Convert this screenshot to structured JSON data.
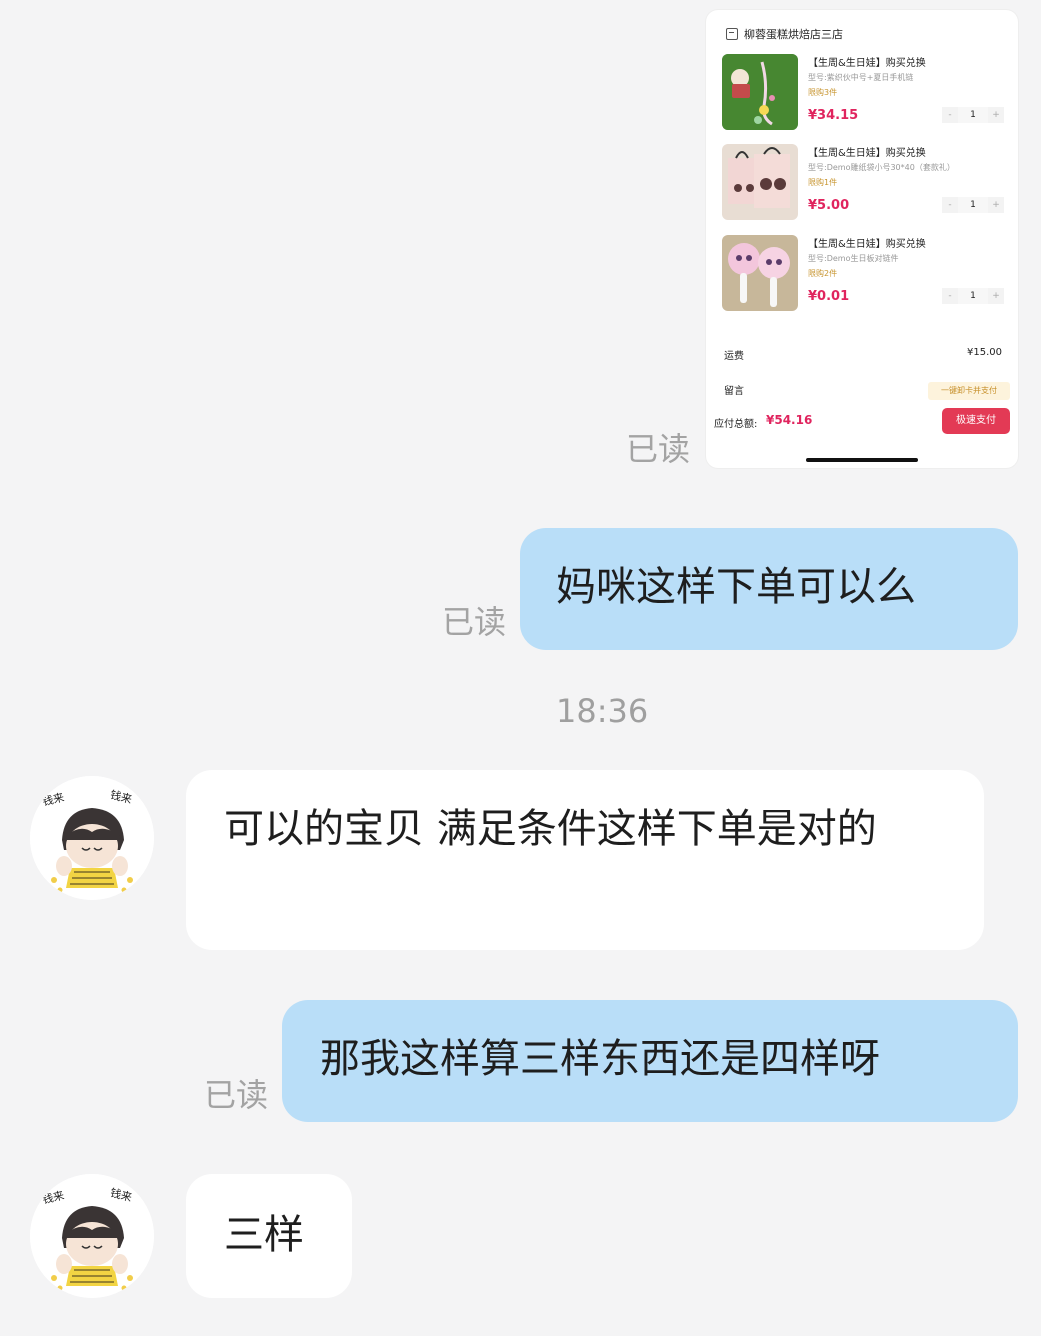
{
  "card": {
    "shop_name": "柳蓉蛋糕烘焙店三店",
    "items": [
      {
        "title": "【生周&生日娃】购买兑换",
        "spec": "型号:紫织伙中号+夏日手机链",
        "limit": "限购3件",
        "price": "¥34.15",
        "qty": "1",
        "minus": "-",
        "plus": "+"
      },
      {
        "title": "【生周&生日娃】购买兑换",
        "spec": "型号:Demo雕纸袋小号30*40（套款礼）",
        "limit": "限购1件",
        "price": "¥5.00",
        "qty": "1",
        "minus": "-",
        "plus": "+"
      },
      {
        "title": "【生周&生日娃】购买兑换",
        "spec": "型号:Demo生日板对链件",
        "limit": "限购2件",
        "price": "¥0.01",
        "qty": "1",
        "minus": "-",
        "plus": "+"
      }
    ],
    "shipping_label": "运费",
    "shipping_value": "¥15.00",
    "memo_label": "留言",
    "card_pay_label": "一键卸卡并支付",
    "total_label": "应付总额:",
    "total_value": "¥54.16",
    "pay_button": "极速支付"
  },
  "messages": {
    "read_label": "已读",
    "msg1": "妈咪这样下单可以么",
    "time1": "18:36",
    "msg2": "可以的宝贝 满足条件这样下单是对的",
    "msg3": "那我这样算三样东西还是四样呀",
    "msg4": "三样"
  },
  "avatar": {
    "label": "钱来"
  },
  "colors": {
    "outgoing_bubble": "#b9def8",
    "incoming_bubble": "#ffffff",
    "price": "#e0245e",
    "pay_button": "#e33a55",
    "background": "#f4f4f5"
  }
}
